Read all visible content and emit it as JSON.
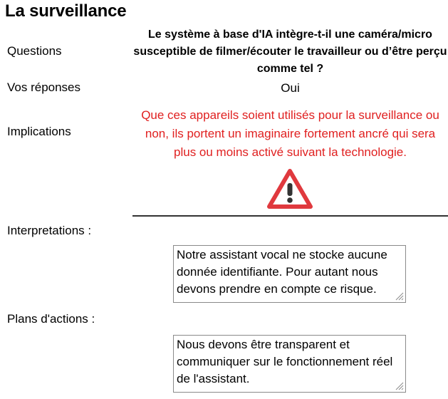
{
  "page": {
    "title": "La surveillance"
  },
  "labels": {
    "questions": "Questions",
    "answers": "Vos réponses",
    "implications": "Implications",
    "interpretations": "Interpretations :",
    "action_plans": "Plans d'actions :"
  },
  "content": {
    "question": "Le système à base d'IA intègre-t-il une caméra/micro susceptible de filmer/écouter le travailleur ou d’être perçu comme tel ?",
    "answer": "Oui",
    "implication": "Que ces appareils soient utilisés pour la surveillance ou non, ils portent un imaginaire fortement ancré qui sera plus ou moins activé suivant la technologie.",
    "interpretation_text": "Notre assistant vocal ne stocke aucune donnée identifiante. Pour autant nous devons prendre en compte ce risque.",
    "action_plan_text": "Nous devons être transparent et communiquer sur le fonctionnement réel de l'assistant."
  },
  "colors": {
    "implication_text": "#e02020",
    "warning_icon": "#e0393e",
    "divider": "#333333"
  },
  "icons": {
    "warning": "warning-triangle-icon"
  }
}
